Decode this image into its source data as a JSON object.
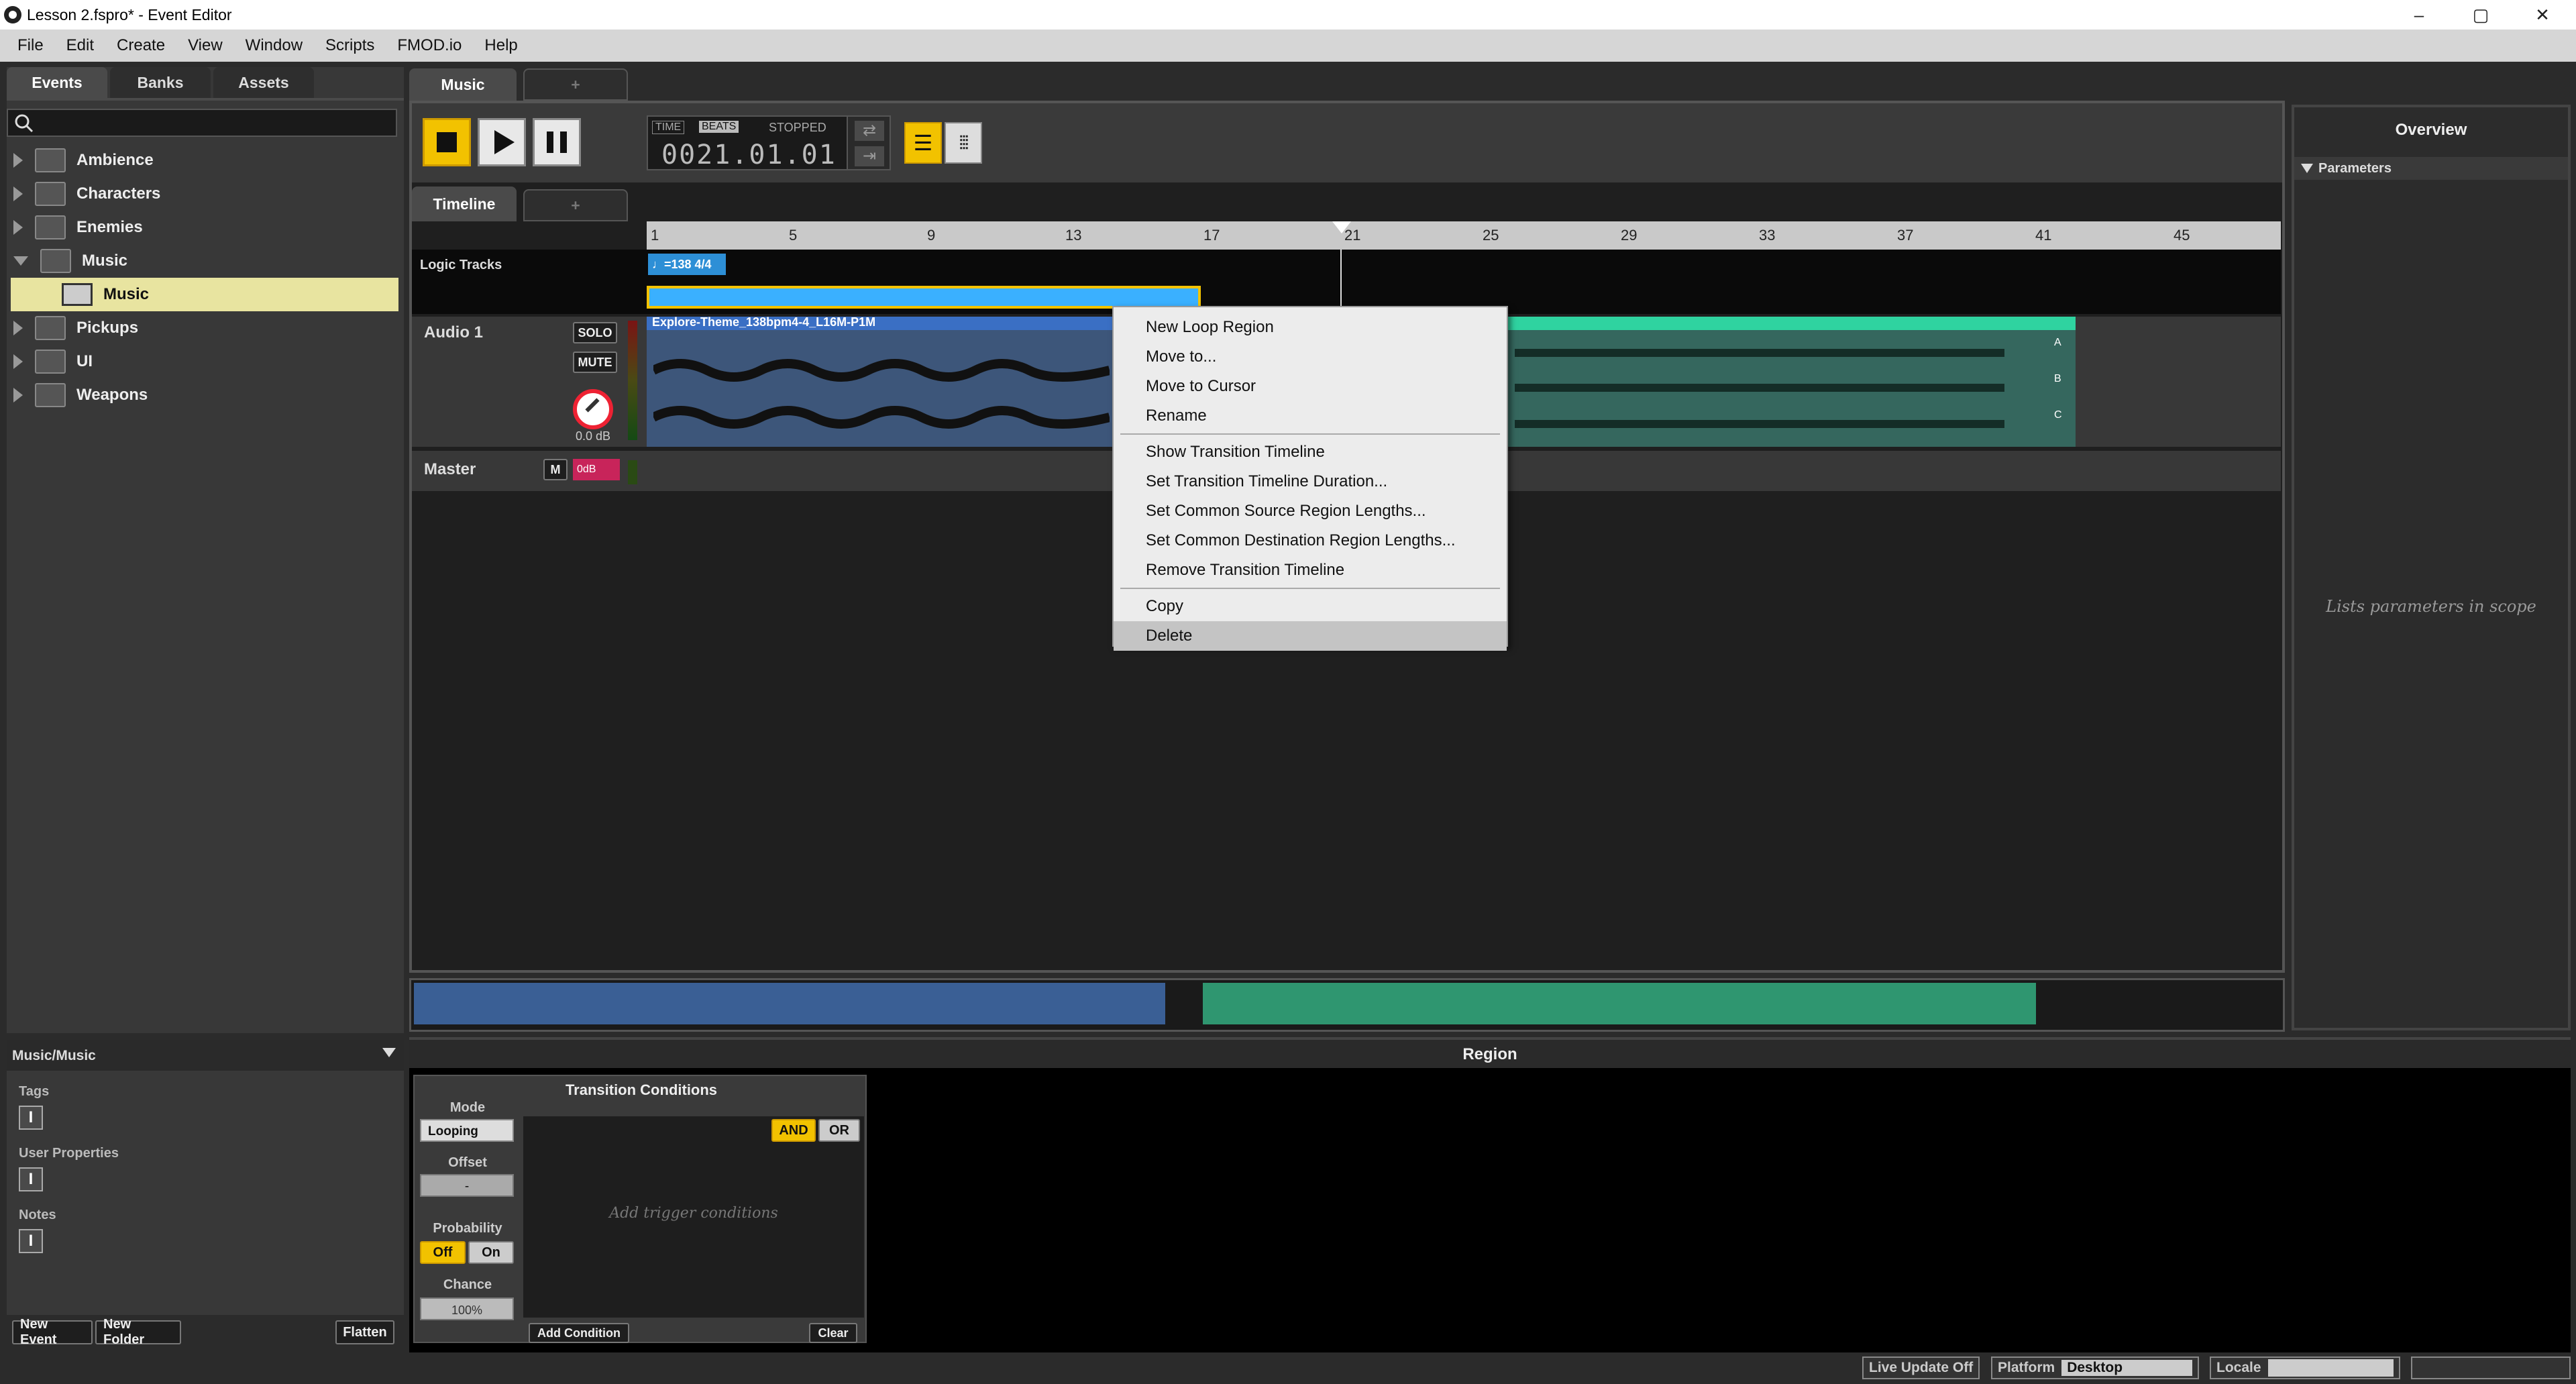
{
  "window": {
    "title": "Lesson 2.fspro* - Event Editor",
    "minimize": "–",
    "restore": "▢",
    "close": "✕"
  },
  "menu": [
    "File",
    "Edit",
    "Create",
    "View",
    "Window",
    "Scripts",
    "FMOD.io",
    "Help"
  ],
  "left_tabs": [
    "Events",
    "Banks",
    "Assets"
  ],
  "search": {
    "placeholder": "",
    "icon": "search-icon"
  },
  "tree": [
    {
      "label": "Ambience",
      "expanded": false
    },
    {
      "label": "Characters",
      "expanded": false
    },
    {
      "label": "Enemies",
      "expanded": false
    },
    {
      "label": "Music",
      "expanded": true
    },
    {
      "label": "Music",
      "child": true,
      "selected": true
    },
    {
      "label": "Pickups",
      "expanded": false
    },
    {
      "label": "UI",
      "expanded": false
    },
    {
      "label": "Weapons",
      "expanded": false
    }
  ],
  "left_bottom": {
    "path": "Music/Music",
    "tags": "Tags",
    "user_properties": "User Properties",
    "notes": "Notes",
    "new_event": "New Event",
    "new_folder": "New Folder",
    "flatten": "Flatten"
  },
  "editor": {
    "event_tab": "Music",
    "add_tab": "+",
    "timeline_tab": "Timeline",
    "time_label": "TIME",
    "beats_label": "BEATS",
    "state": "STOPPED",
    "position": "0021.01.01",
    "logic_tracks": "Logic Tracks",
    "tempo_marker": "♩=138 4/4",
    "track1": {
      "name": "Audio 1",
      "solo": "SOLO",
      "mute": "MUTE",
      "gain": "0.0 dB",
      "region": "Explore-Theme_138bpm4-4_L16M-P1M"
    },
    "master": {
      "name": "Master",
      "m": "M",
      "fx": "0dB"
    },
    "ruler": [
      "1",
      "5",
      "9",
      "13",
      "17",
      "21",
      "25",
      "29",
      "33",
      "37",
      "41",
      "45"
    ],
    "markers": [
      "A",
      "B",
      "C"
    ]
  },
  "context_menu": {
    "items": [
      "New Loop Region",
      "Move to...",
      "Move to Cursor",
      "Rename",
      "Show Transition Timeline",
      "Set Transition Timeline Duration...",
      "Set Common Source Region Lengths...",
      "Set Common Destination Region Lengths...",
      "Remove Transition Timeline",
      "Copy",
      "Delete"
    ]
  },
  "overview": {
    "title": "Overview",
    "section": "Parameters",
    "empty": "Lists parameters in scope"
  },
  "region": {
    "title": "Region",
    "transition_title": "Transition Conditions",
    "mode_label": "Mode",
    "mode_value": "Looping",
    "offset_label": "Offset",
    "offset_value": "-",
    "probability_label": "Probability",
    "off": "Off",
    "on": "On",
    "chance_label": "Chance",
    "chance_value": "100%",
    "and": "AND",
    "or": "OR",
    "empty": "Add trigger conditions",
    "add_condition": "Add Condition",
    "clear": "Clear"
  },
  "status": {
    "live_update": "Live Update Off",
    "platform_label": "Platform",
    "platform_value": "Desktop",
    "locale_label": "Locale"
  },
  "colors": {
    "accent": "#f2c200",
    "region_blue": "#3a6fc4",
    "region_green": "#2fd3a0",
    "tempo": "#2d8fd6"
  }
}
